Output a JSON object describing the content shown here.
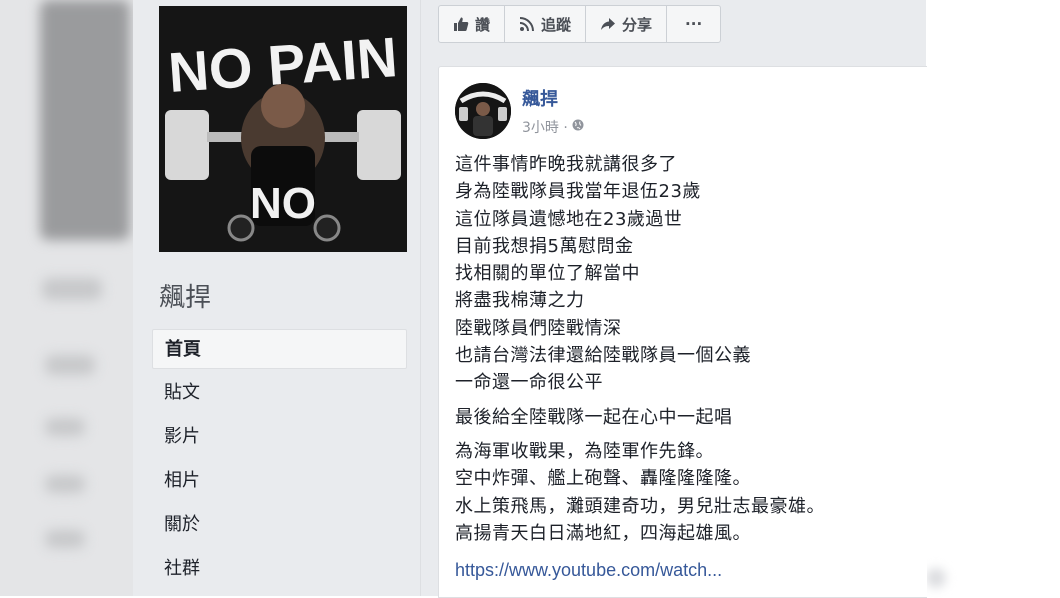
{
  "sidebar": {
    "cover_text_top": "NO PAIN",
    "cover_text_bottom": "NO",
    "page_name": "飆捍",
    "nav": [
      {
        "label": "首頁",
        "active": true
      },
      {
        "label": "貼文"
      },
      {
        "label": "影片"
      },
      {
        "label": "相片"
      },
      {
        "label": "關於"
      },
      {
        "label": "社群"
      }
    ]
  },
  "actions": {
    "like": "讚",
    "follow": "追蹤",
    "share": "分享",
    "more": "···"
  },
  "post": {
    "author": "飆捍",
    "time": "3小時 ·",
    "lines_1": [
      "這件事情昨晚我就講很多了",
      "身為陸戰隊員我當年退伍23歲",
      "這位隊員遺憾地在23歲過世",
      "目前我想捐5萬慰問金",
      "找相關的單位了解當中",
      "將盡我棉薄之力",
      "陸戰隊員們陸戰情深",
      "也請台灣法律還給陸戰隊員一個公義",
      "一命還一命很公平"
    ],
    "line_2": "最後給全陸戰隊一起在心中一起唱",
    "lines_3": [
      "為海軍收戰果，為陸軍作先鋒。",
      "空中炸彈、艦上砲聲、轟隆隆隆隆。",
      "水上策飛馬，灘頭建奇功，男兒壯志最豪雄。",
      "高揚青天白日滿地紅，四海起雄風。"
    ],
    "link": "https://www.youtube.com/watch..."
  },
  "colors": {
    "link": "#365899",
    "panel_bg": "#e9ebee",
    "text": "#1d2129"
  }
}
